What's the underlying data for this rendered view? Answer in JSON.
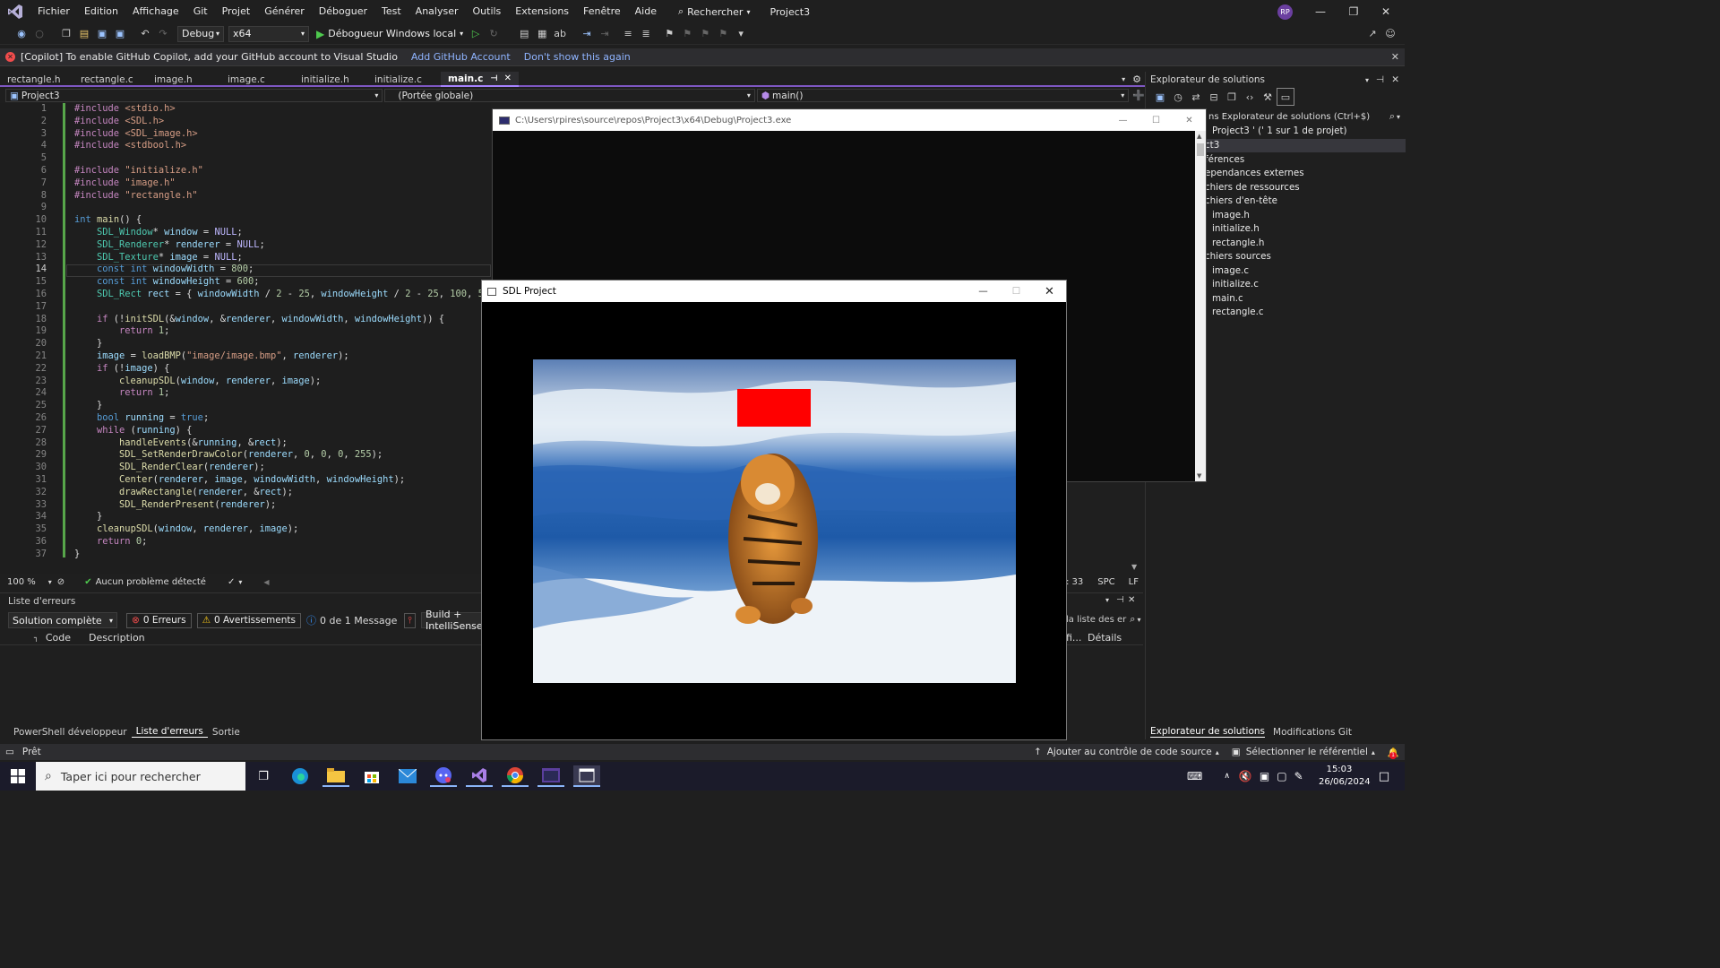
{
  "menubar": {
    "items": [
      "Fichier",
      "Edition",
      "Affichage",
      "Git",
      "Projet",
      "Générer",
      "Déboguer",
      "Test",
      "Analyser",
      "Outils",
      "Extensions",
      "Fenêtre",
      "Aide"
    ],
    "search_label": "Rechercher",
    "project_name": "Project3",
    "avatar_initials": "RP"
  },
  "toolbar": {
    "config": "Debug",
    "platform": "x64",
    "debugger": "Débogueur Windows local"
  },
  "infobar": {
    "message": "[Copilot] To enable GitHub Copilot, add your GitHub account to Visual Studio",
    "link_add": "Add GitHub Account",
    "link_dismiss": "Don't show this again"
  },
  "tabs": [
    {
      "label": "rectangle.h",
      "active": false
    },
    {
      "label": "rectangle.c",
      "active": false
    },
    {
      "label": "image.h",
      "active": false
    },
    {
      "label": "image.c",
      "active": false
    },
    {
      "label": "initialize.h",
      "active": false
    },
    {
      "label": "initialize.c",
      "active": false
    },
    {
      "label": "main.c",
      "active": true
    }
  ],
  "navbar": {
    "project": "Project3",
    "scope": "(Portée globale)",
    "member": "main()"
  },
  "editor": {
    "zoom": "100 %",
    "problems": "Aucun problème détecté",
    "current_line": 14,
    "line_numbers": [
      "1",
      "2",
      "3",
      "4",
      "5",
      "6",
      "7",
      "8",
      "9",
      "10",
      "11",
      "12",
      "13",
      "14",
      "15",
      "16",
      "17",
      "18",
      "19",
      "20",
      "21",
      "22",
      "23",
      "24",
      "25",
      "26",
      "27",
      "28",
      "29",
      "30",
      "31",
      "32",
      "33",
      "34",
      "35",
      "36",
      "37"
    ]
  },
  "errors": {
    "title": "Liste d'erreurs",
    "scope": "Solution complète",
    "errors_label": "0 Erreurs",
    "warnings_label": "0 Avertissements",
    "messages_label": "0 de 1 Message",
    "build_filter": "Build + IntelliSense",
    "search_placeholder": "la liste des er",
    "col_code": "Code",
    "col_description": "Description",
    "col_file": "fi...",
    "col_details": "Détails",
    "editor_col": ": 33",
    "spc": "SPC",
    "lf": "LF"
  },
  "bottom_tabs": [
    "PowerShell développeur",
    "Liste d'erreurs",
    "Sortie"
  ],
  "status": {
    "ready": "Prêt",
    "source_control": "Ajouter au contrôle de code source",
    "repository": "Sélectionner le référentiel",
    "notifications": "1"
  },
  "solution_explorer": {
    "title": "Explorateur de solutions",
    "search": "ns Explorateur de solutions (Ctrl+$)",
    "solution_line": "Project3 ' (' 1 sur 1 de projet)",
    "items": [
      "ct3",
      "férences",
      "ependances externes",
      "chiers de ressources",
      "chiers d'en-tête",
      "image.h",
      "initialize.h",
      "rectangle.h",
      "chiers sources",
      "image.c",
      "initialize.c",
      "main.c",
      "rectangle.c"
    ],
    "tab_solution": "Explorateur de solutions",
    "tab_git": "Modifications Git"
  },
  "console_window": {
    "title": "C:\\Users\\rpires\\source\\repos\\Project3\\x64\\Debug\\Project3.exe"
  },
  "sdl_window": {
    "title": "SDL Project"
  },
  "taskbar": {
    "search_placeholder": "Taper ici pour rechercher",
    "time": "15:03",
    "date": "26/06/2024"
  },
  "colors": {
    "accent": "#7e57c2",
    "rect": "#ff0000",
    "error": "#f14c4c"
  }
}
